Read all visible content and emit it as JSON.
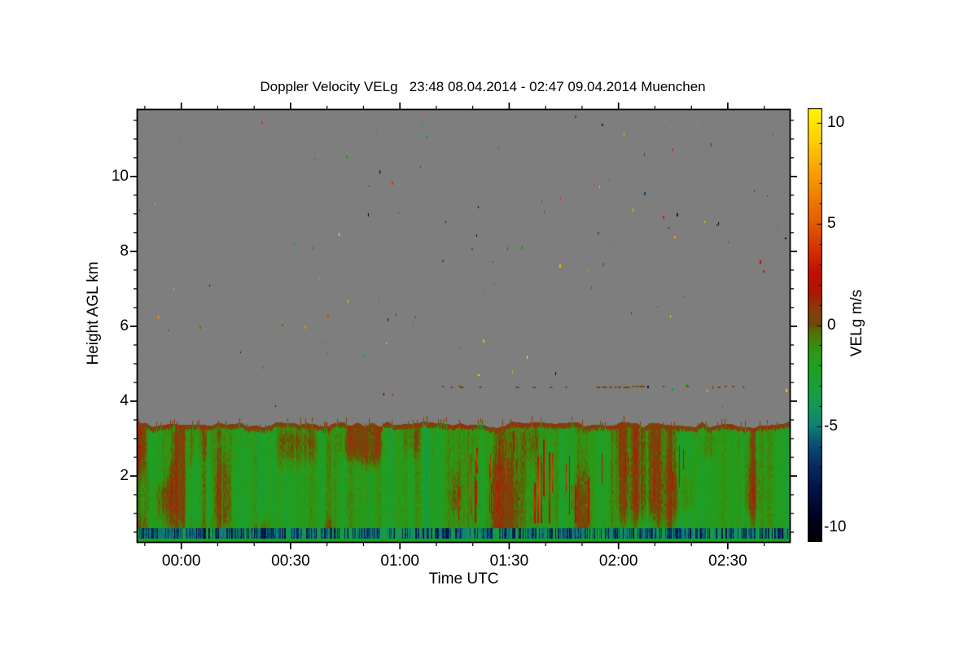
{
  "chart_data": {
    "type": "heatmap",
    "title": "Doppler Velocity VELg   23:48 08.04.2014 - 02:47 09.04.2014 Muenchen",
    "xlabel": "Time UTC",
    "ylabel": "Height AGL km",
    "colorbar_label": "VELg m/s",
    "time_start": "23:48 08.04.2014",
    "time_end": "02:47 09.04.2014",
    "site": "Muenchen",
    "x_axis": {
      "range_minutes": [
        0,
        179
      ],
      "major_ticks": [
        {
          "minute": 12,
          "label": "00:00"
        },
        {
          "minute": 42,
          "label": "00:30"
        },
        {
          "minute": 72,
          "label": "01:00"
        },
        {
          "minute": 102,
          "label": "01:30"
        },
        {
          "minute": 132,
          "label": "02:00"
        },
        {
          "minute": 162,
          "label": "02:30"
        }
      ],
      "minor_step_minutes": 10,
      "minor_phase_minute": 2
    },
    "y_axis": {
      "range_km": [
        0.24,
        11.78
      ],
      "major_ticks_km": [
        2,
        4,
        6,
        8,
        10
      ],
      "minor_step_km": 0.5
    },
    "colorbar": {
      "range": [
        -10.72,
        10.72
      ],
      "major_ticks": [
        10,
        5,
        0,
        -5,
        -10
      ],
      "minor_step": 1,
      "stops": [
        [
          -10.72,
          "#000000"
        ],
        [
          -9.5,
          "#000122"
        ],
        [
          -8.0,
          "#03154a"
        ],
        [
          -6.8,
          "#072f62"
        ],
        [
          -5.8,
          "#0b5572"
        ],
        [
          -5.0,
          "#0f8076"
        ],
        [
          -4.2,
          "#12945f"
        ],
        [
          -3.2,
          "#17a03c"
        ],
        [
          -2.2,
          "#1f9f25"
        ],
        [
          -1.4,
          "#2b9a16"
        ],
        [
          -0.7,
          "#44800c"
        ],
        [
          -0.2,
          "#5d6607"
        ],
        [
          0.0,
          "#6b4a08"
        ],
        [
          0.5,
          "#7e440a"
        ],
        [
          1.0,
          "#92330a"
        ],
        [
          1.6,
          "#ac1602"
        ],
        [
          2.6,
          "#bf1000"
        ],
        [
          3.6,
          "#d22d00"
        ],
        [
          5.0,
          "#e25a00"
        ],
        [
          6.5,
          "#f08200"
        ],
        [
          8.0,
          "#f9ad00"
        ],
        [
          9.3,
          "#ffd400"
        ],
        [
          10.72,
          "#fff500"
        ]
      ]
    },
    "field": {
      "no_data_color": "#7e7e7e",
      "cloud_top_km": 3.38,
      "mean_velocity_ms": -1.6,
      "fringe_velocity_ms": 0.55,
      "red_streak_velocity_ms": 3.2,
      "red_streak_time_window_minutes": [
        87,
        125
      ],
      "surface_band_km": [
        0.33,
        0.63
      ],
      "surface_band_velocity_ms": -4.3,
      "surface_streak_velocity_ms": -7.5,
      "aerosol_layer_km": 4.39,
      "aerosol_layer_minutes": [
        76,
        170
      ],
      "aerosol_cluster_minutes": [
        126,
        138
      ],
      "noise_speckle_count": 120,
      "seed": 1337
    }
  }
}
